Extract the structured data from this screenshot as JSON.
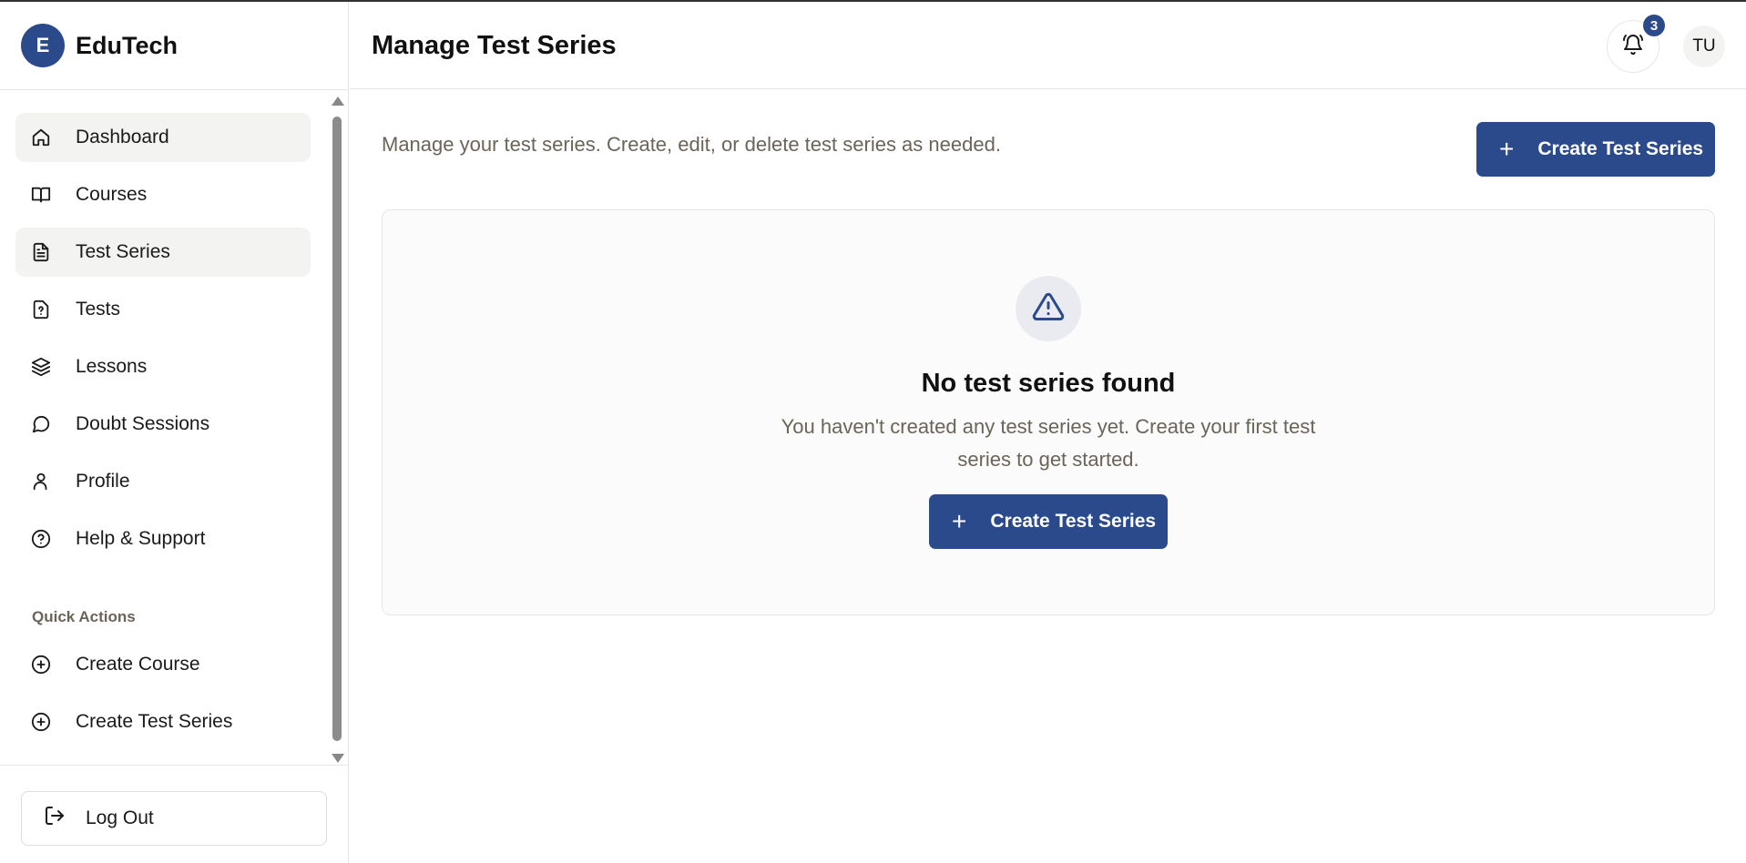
{
  "brand": {
    "logo_letter": "E",
    "name": "EduTech"
  },
  "sidebar": {
    "items": [
      {
        "label": "Dashboard",
        "icon": "home-icon"
      },
      {
        "label": "Courses",
        "icon": "book-icon"
      },
      {
        "label": "Test Series",
        "icon": "document-icon"
      },
      {
        "label": "Tests",
        "icon": "question-file-icon"
      },
      {
        "label": "Lessons",
        "icon": "layers-icon"
      },
      {
        "label": "Doubt Sessions",
        "icon": "message-icon"
      },
      {
        "label": "Profile",
        "icon": "user-icon"
      },
      {
        "label": "Help & Support",
        "icon": "help-circle-icon"
      }
    ],
    "quick_actions_title": "Quick Actions",
    "quick_actions": [
      {
        "label": "Create Course",
        "icon": "plus-circle-icon"
      },
      {
        "label": "Create Test Series",
        "icon": "plus-circle-icon"
      }
    ],
    "logout_label": "Log Out"
  },
  "header": {
    "title": "Manage Test Series",
    "notification_count": "3",
    "avatar_initials": "TU"
  },
  "main": {
    "description": "Manage your test series. Create, edit, or delete test series as needed.",
    "create_button_label": "Create Test Series",
    "empty_state": {
      "title": "No test series found",
      "message": "You haven't created any test series yet. Create your first test series to get started.",
      "button_label": "Create Test Series"
    }
  },
  "colors": {
    "primary": "#2b4a8b",
    "muted_text": "#6b6458",
    "active_bg": "#f3f3f2"
  }
}
